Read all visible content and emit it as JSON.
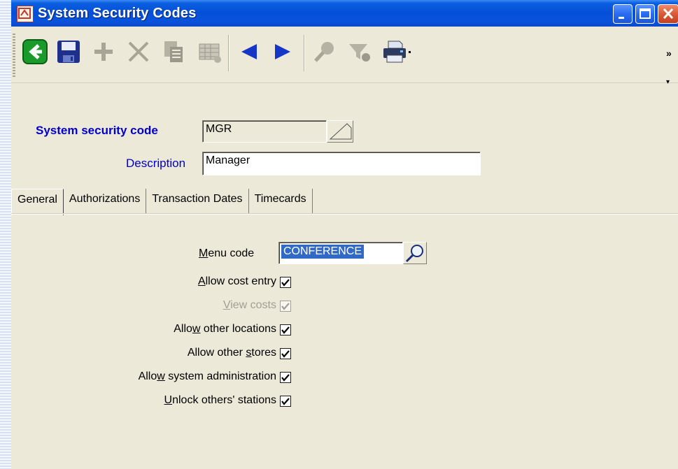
{
  "window": {
    "title": "System Security Codes"
  },
  "toolbar": {
    "buttons": [
      {
        "name": "back",
        "icon": "back-arrow-icon"
      },
      {
        "name": "save",
        "icon": "floppy-disk-icon"
      },
      {
        "name": "add",
        "icon": "plus-icon"
      },
      {
        "name": "delete",
        "icon": "x-icon"
      },
      {
        "name": "copy",
        "icon": "copy-icon"
      },
      {
        "name": "grid",
        "icon": "grid-icon"
      },
      {
        "name": "previous",
        "icon": "triangle-left-icon"
      },
      {
        "name": "next",
        "icon": "triangle-right-icon"
      },
      {
        "name": "find",
        "icon": "magnifier-icon"
      },
      {
        "name": "filter",
        "icon": "funnel-icon"
      },
      {
        "name": "print",
        "icon": "printer-icon"
      }
    ],
    "overflow_chevron": "»"
  },
  "form": {
    "security_code_label": "System security code",
    "security_code_value": "MGR",
    "description_label": "Description",
    "description_value": "Manager"
  },
  "tabs": [
    {
      "label": "General",
      "active": true
    },
    {
      "label": "Authorizations",
      "active": false
    },
    {
      "label": "Transaction Dates",
      "active": false
    },
    {
      "label": "Timecards",
      "active": false
    }
  ],
  "general": {
    "menu_code": {
      "label_pre": "",
      "label_ul": "M",
      "label_post": "enu code",
      "value": "CONFERENCE"
    },
    "checkboxes": [
      {
        "label_pre": "",
        "label_ul": "A",
        "label_post": "llow cost entry",
        "checked": true,
        "disabled": false
      },
      {
        "label_pre": "",
        "label_ul": "V",
        "label_post": "iew costs",
        "checked": true,
        "disabled": true
      },
      {
        "label_pre": "Allo",
        "label_ul": "w",
        "label_post": " other locations",
        "checked": true,
        "disabled": false
      },
      {
        "label_pre": "Allow other ",
        "label_ul": "s",
        "label_post": "tores",
        "checked": true,
        "disabled": false
      },
      {
        "label_pre": "Allo",
        "label_ul": "w",
        "label_post": " system administration",
        "checked": true,
        "disabled": false
      },
      {
        "label_pre": "",
        "label_ul": "U",
        "label_post": "nlock others' stations",
        "checked": true,
        "disabled": false
      }
    ]
  },
  "colors": {
    "titlebar": "#0550d8",
    "label_blue": "#0000cc",
    "selection": "#316ac5",
    "window_bg": "#ece9d8"
  }
}
